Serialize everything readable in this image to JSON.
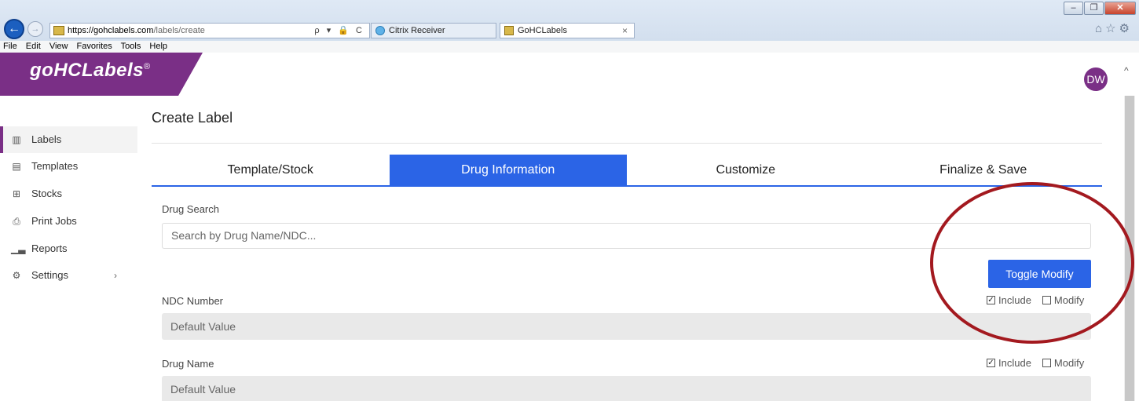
{
  "browser": {
    "url_host": "https://gohclabels.com",
    "url_path": "/labels/create",
    "tabs": [
      {
        "title": "Citrix Receiver"
      },
      {
        "title": "GoHCLabels",
        "close": "×"
      }
    ],
    "menu": [
      "File",
      "Edit",
      "View",
      "Favorites",
      "Tools",
      "Help"
    ],
    "addr_tools": "ρ ▾ 🔒 C"
  },
  "header": {
    "logo_text": "goHCLabels",
    "logo_mark": "®",
    "user_initials": "DW",
    "brand_color": "#7a2f86"
  },
  "sidebar": {
    "items": [
      {
        "label": "Labels",
        "icon": "barcode-icon",
        "glyph": "▥",
        "active": true
      },
      {
        "label": "Templates",
        "icon": "templates-icon",
        "glyph": "▤"
      },
      {
        "label": "Stocks",
        "icon": "grid-icon",
        "glyph": "⊞"
      },
      {
        "label": "Print Jobs",
        "icon": "printer-icon",
        "glyph": "⎙"
      },
      {
        "label": "Reports",
        "icon": "chart-icon",
        "glyph": "▁▃"
      },
      {
        "label": "Settings",
        "icon": "gears-icon",
        "glyph": "⚙",
        "chevron": "›"
      }
    ]
  },
  "main": {
    "title": "Create Label",
    "steps": [
      {
        "label": "Template/Stock"
      },
      {
        "label": "Drug Information",
        "active": true
      },
      {
        "label": "Customize"
      },
      {
        "label": "Finalize & Save"
      }
    ],
    "accent_color": "#2b64e6",
    "drug_search": {
      "label": "Drug Search",
      "placeholder": "Search by Drug Name/NDC..."
    },
    "toggle_button": "Toggle Modify",
    "fields": [
      {
        "label": "NDC Number",
        "value": "Default Value",
        "include_label": "Include",
        "include_checked": true,
        "modify_label": "Modify",
        "modify_checked": false
      },
      {
        "label": "Drug Name",
        "value": "Default Value",
        "include_label": "Include",
        "include_checked": true,
        "modify_label": "Modify",
        "modify_checked": false
      }
    ]
  },
  "annotation_color": "#a3191f"
}
